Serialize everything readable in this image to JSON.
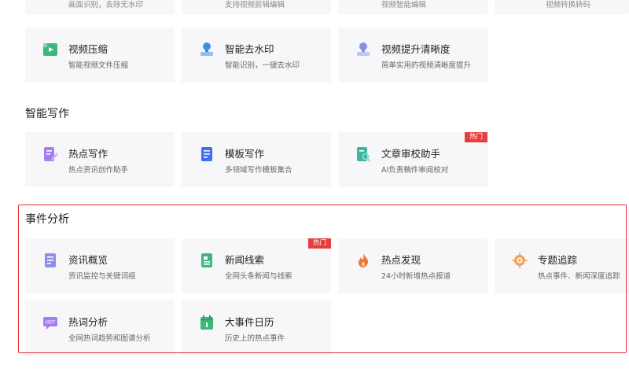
{
  "top_partial": {
    "cards": [
      {
        "desc": "画面识别，去除无水印"
      },
      {
        "desc": "支持视频剪辑编辑"
      },
      {
        "desc": "视频智能编辑"
      },
      {
        "desc": "视频转换转码"
      }
    ]
  },
  "video_row": [
    {
      "title": "视频压缩",
      "desc": "智能视频文件压缩",
      "icon": "video-compress-icon"
    },
    {
      "title": "智能去水印",
      "desc": "智能识别，一键去水印",
      "icon": "stamp-icon"
    },
    {
      "title": "视频提升清晰度",
      "desc": "简单实用的视频清晰度提升",
      "icon": "enhance-icon"
    }
  ],
  "writing": {
    "title": "智能写作",
    "cards": [
      {
        "title": "热点写作",
        "desc": "热点资讯创作助手",
        "hot": ""
      },
      {
        "title": "模板写作",
        "desc": "多领域写作模板集合",
        "hot": ""
      },
      {
        "title": "文章审校助手",
        "desc": "AI负责稿件审阅校对",
        "hot": "热门"
      }
    ]
  },
  "events": {
    "title": "事件分析",
    "cards": [
      {
        "title": "资讯概览",
        "desc": "资讯监控与关键词组",
        "hot": ""
      },
      {
        "title": "新闻线索",
        "desc": "全网头条新闻与线索",
        "hot": "热门"
      },
      {
        "title": "热点发现",
        "desc": "24小时新增热点报道",
        "hot": ""
      },
      {
        "title": "专题追踪",
        "desc": "热点事件、新闻深度追踪",
        "hot": ""
      },
      {
        "title": "热词分析",
        "desc": "全网热词趋势和图谱分析",
        "hot": ""
      },
      {
        "title": "大事件日历",
        "desc": "历史上的热点事件",
        "hot": ""
      }
    ]
  },
  "colors": {
    "accent_red": "#e63e3e",
    "highlight_border": "#e8312f"
  }
}
